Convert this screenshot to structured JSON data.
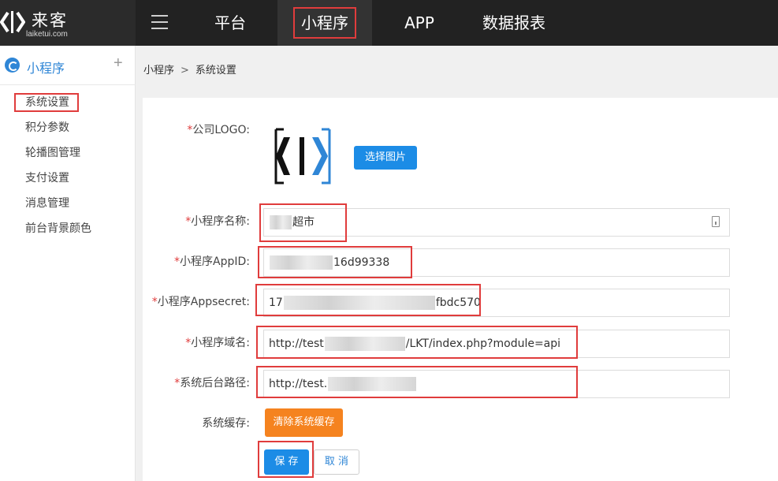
{
  "brand": {
    "name_cn": "来客",
    "name_en": "laiketui.com"
  },
  "top_nav": {
    "items": [
      {
        "label": "平台"
      },
      {
        "label": "小程序"
      },
      {
        "label": "APP"
      },
      {
        "label": "数据报表"
      }
    ],
    "active_index": 1
  },
  "sidebar": {
    "title": "小程序",
    "plus_symbol": "+",
    "items": [
      {
        "label": "系统设置"
      },
      {
        "label": "积分参数"
      },
      {
        "label": "轮播图管理"
      },
      {
        "label": "支付设置"
      },
      {
        "label": "消息管理"
      },
      {
        "label": "前台背景颜色"
      }
    ],
    "active_index": 0
  },
  "breadcrumb": {
    "parent": "小程序",
    "separator": ">",
    "current": "系统设置"
  },
  "form": {
    "required_mark": "*",
    "company_logo": {
      "label": "公司LOGO:",
      "button": "选择图片"
    },
    "app_name": {
      "label": "小程序名称:",
      "value_visible": "超市"
    },
    "app_id": {
      "label": "小程序AppID:",
      "value_prefix": "",
      "value_suffix": "16d99338"
    },
    "app_secret": {
      "label": "小程序Appsecret:",
      "value_prefix": "17",
      "value_suffix": "fbdc570"
    },
    "domain": {
      "label": "小程序域名:",
      "value_prefix": "http://test",
      "value_suffix": "/LKT/index.php?module=api"
    },
    "backend_path": {
      "label": "系统后台路径:",
      "value_prefix": "http://test.",
      "value_suffix": ""
    },
    "cache": {
      "label": "系统缓存:",
      "button": "清除系统缓存"
    },
    "save_button": "保 存",
    "cancel_button": "取 消"
  },
  "colors": {
    "accent": "#1c8ce6",
    "orange": "#f5831f",
    "highlight": "#e03c3c",
    "topbar": "#222222"
  }
}
